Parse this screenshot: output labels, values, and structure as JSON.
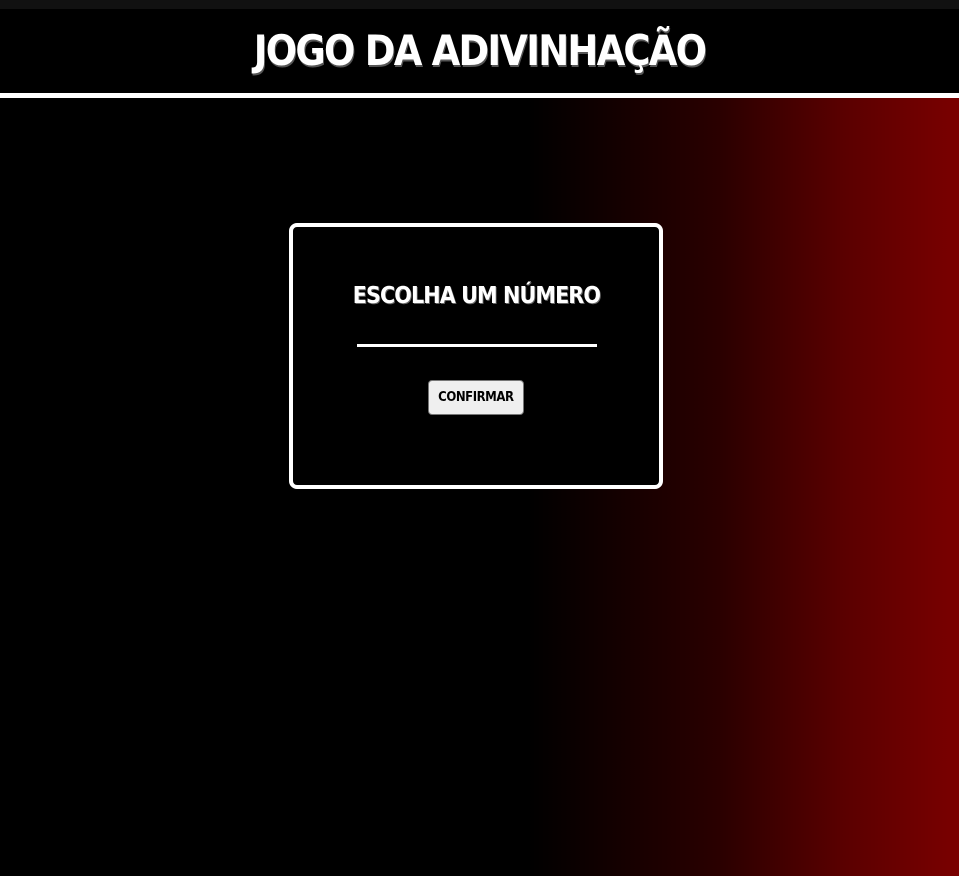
{
  "header": {
    "title": "JOGO DA ADIVINHAÇÃO"
  },
  "card": {
    "title": "ESCOLHA UM NÚMERO",
    "input": {
      "value": "",
      "placeholder": ""
    },
    "confirm_label": "CONFIRMAR"
  },
  "colors": {
    "background_left": "#000000",
    "background_right": "#7a0000",
    "card_border": "#ffffff",
    "text": "#ffffff",
    "button_background": "#efefef"
  }
}
